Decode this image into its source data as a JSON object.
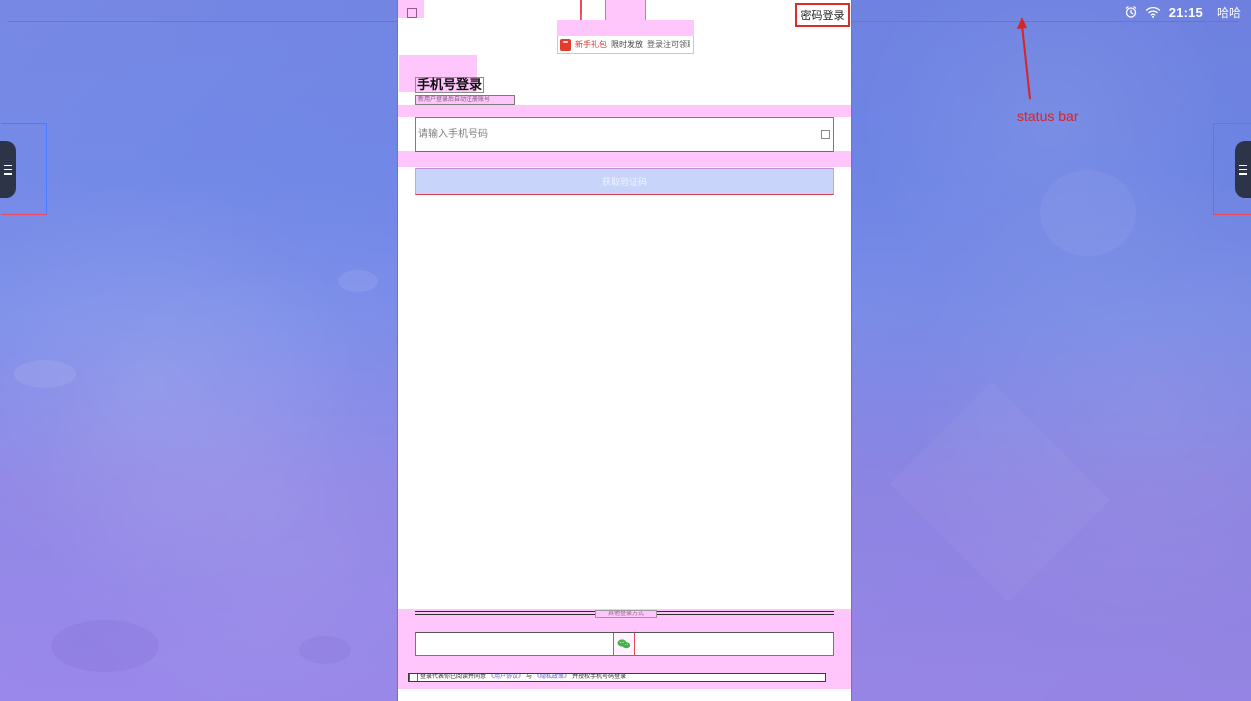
{
  "status_bar": {
    "time": "21:15",
    "user": "哈哈",
    "alarm_icon": "alarm-icon",
    "wifi_icon": "wifi-icon",
    "annotation": "status bar",
    "accent_color": "#ea4a58"
  },
  "login_screen": {
    "password_login_label": "密码登录",
    "promo": {
      "icon": "red-envelope-icon",
      "label": "新手礼包",
      "timing": "限时发放",
      "description": "登录注可领取"
    },
    "title": "手机号登录",
    "subtitle": "新用户登录后自动注册账号",
    "phone_input": {
      "value": "",
      "placeholder": "请输入手机号码"
    },
    "otp_button_label": "获取验证码",
    "other_login_label": "其他登录方式",
    "other_login_icon": "wechat-icon",
    "agreement": {
      "prefix": "登录代表你已阅读并同意",
      "user_agreement": "《用户协议》",
      "connector": "与",
      "privacy_policy": "《隐私政策》",
      "suffix": "并授权手机号码登录"
    }
  },
  "side_handles": {
    "left_icon": "menu-handle-icon",
    "right_icon": "menu-handle-icon"
  }
}
